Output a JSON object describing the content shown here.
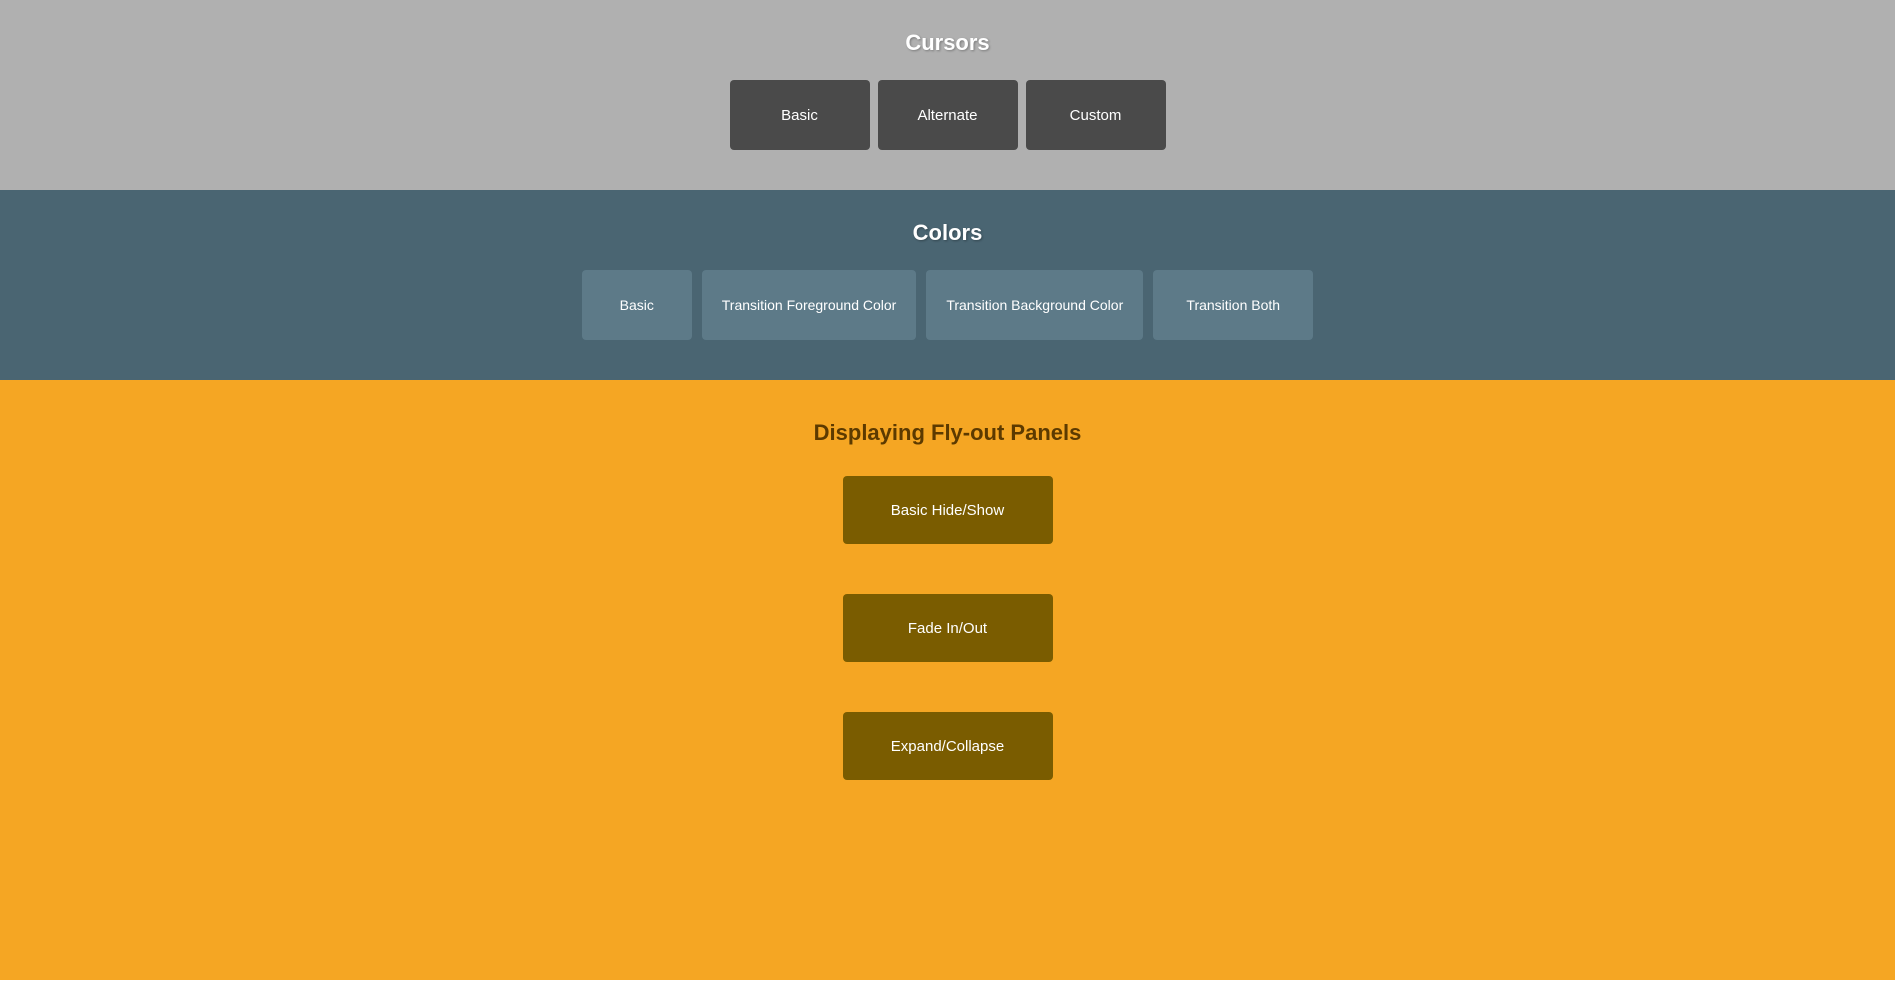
{
  "cursors": {
    "title": "Cursors",
    "buttons": [
      {
        "label": "Basic",
        "id": "basic"
      },
      {
        "label": "Alternate",
        "id": "alternate"
      },
      {
        "label": "Custom",
        "id": "custom"
      }
    ]
  },
  "colors": {
    "title": "Colors",
    "buttons": [
      {
        "label": "Basic",
        "id": "basic"
      },
      {
        "label": "Transition Foreground Color",
        "id": "transition-fg"
      },
      {
        "label": "Transition Background Color",
        "id": "transition-bg"
      },
      {
        "label": "Transition Both",
        "id": "transition-both"
      }
    ]
  },
  "flyout": {
    "title": "Displaying Fly-out Panels",
    "buttons": [
      {
        "label": "Basic Hide/Show",
        "id": "basic-hide-show"
      },
      {
        "label": "Fade In/Out",
        "id": "fade-in-out"
      },
      {
        "label": "Expand/Collapse",
        "id": "expand-collapse"
      }
    ]
  }
}
